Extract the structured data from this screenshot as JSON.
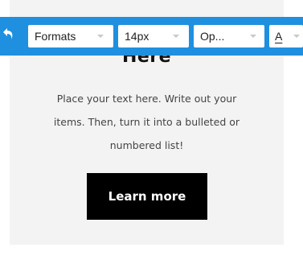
{
  "content": {
    "heading": "Here",
    "body_lines": [
      "Place your text here. Write out your",
      "items. Then, turn it into a bulleted or",
      "numbered list!"
    ],
    "cta_label": "Learn more"
  },
  "toolbar": {
    "color": "#1f8fe0",
    "undo_icon": "undo-arrow-icon",
    "formats_select": {
      "value": "Formats",
      "icon": "chevron-down-icon"
    },
    "font_size_select": {
      "value": "14px",
      "icon": "chevron-down-icon"
    },
    "font_family_select": {
      "value": "Op...",
      "icon": "chevron-down-icon"
    },
    "text_color_select": {
      "value": "A",
      "icon": "chevron-down-icon"
    }
  }
}
